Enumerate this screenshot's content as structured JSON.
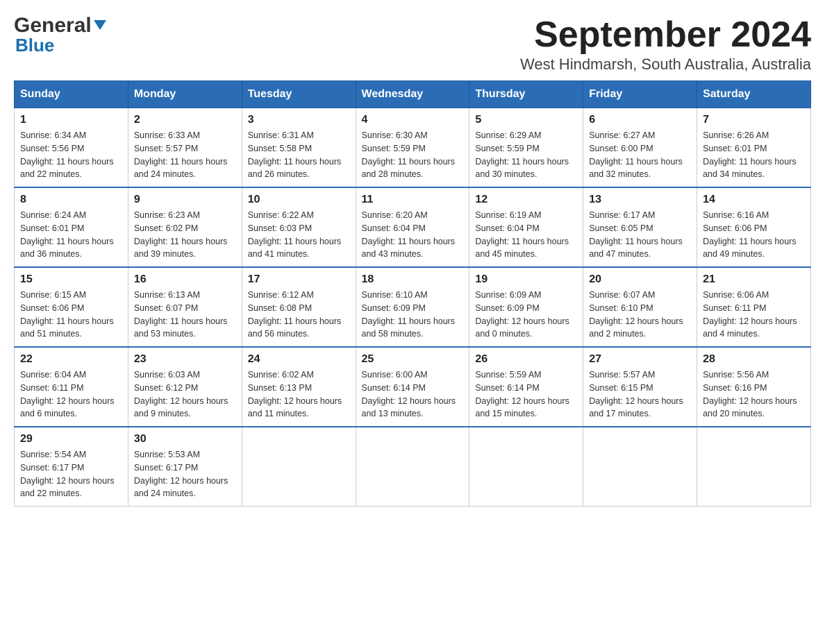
{
  "logo": {
    "line1_normal": "General",
    "line1_arrow": "▶",
    "line2": "Blue"
  },
  "title": "September 2024",
  "subtitle": "West Hindmarsh, South Australia, Australia",
  "weekdays": [
    "Sunday",
    "Monday",
    "Tuesday",
    "Wednesday",
    "Thursday",
    "Friday",
    "Saturday"
  ],
  "weeks": [
    [
      {
        "day": "1",
        "sunrise": "6:34 AM",
        "sunset": "5:56 PM",
        "daylight": "11 hours and 22 minutes."
      },
      {
        "day": "2",
        "sunrise": "6:33 AM",
        "sunset": "5:57 PM",
        "daylight": "11 hours and 24 minutes."
      },
      {
        "day": "3",
        "sunrise": "6:31 AM",
        "sunset": "5:58 PM",
        "daylight": "11 hours and 26 minutes."
      },
      {
        "day": "4",
        "sunrise": "6:30 AM",
        "sunset": "5:59 PM",
        "daylight": "11 hours and 28 minutes."
      },
      {
        "day": "5",
        "sunrise": "6:29 AM",
        "sunset": "5:59 PM",
        "daylight": "11 hours and 30 minutes."
      },
      {
        "day": "6",
        "sunrise": "6:27 AM",
        "sunset": "6:00 PM",
        "daylight": "11 hours and 32 minutes."
      },
      {
        "day": "7",
        "sunrise": "6:26 AM",
        "sunset": "6:01 PM",
        "daylight": "11 hours and 34 minutes."
      }
    ],
    [
      {
        "day": "8",
        "sunrise": "6:24 AM",
        "sunset": "6:01 PM",
        "daylight": "11 hours and 36 minutes."
      },
      {
        "day": "9",
        "sunrise": "6:23 AM",
        "sunset": "6:02 PM",
        "daylight": "11 hours and 39 minutes."
      },
      {
        "day": "10",
        "sunrise": "6:22 AM",
        "sunset": "6:03 PM",
        "daylight": "11 hours and 41 minutes."
      },
      {
        "day": "11",
        "sunrise": "6:20 AM",
        "sunset": "6:04 PM",
        "daylight": "11 hours and 43 minutes."
      },
      {
        "day": "12",
        "sunrise": "6:19 AM",
        "sunset": "6:04 PM",
        "daylight": "11 hours and 45 minutes."
      },
      {
        "day": "13",
        "sunrise": "6:17 AM",
        "sunset": "6:05 PM",
        "daylight": "11 hours and 47 minutes."
      },
      {
        "day": "14",
        "sunrise": "6:16 AM",
        "sunset": "6:06 PM",
        "daylight": "11 hours and 49 minutes."
      }
    ],
    [
      {
        "day": "15",
        "sunrise": "6:15 AM",
        "sunset": "6:06 PM",
        "daylight": "11 hours and 51 minutes."
      },
      {
        "day": "16",
        "sunrise": "6:13 AM",
        "sunset": "6:07 PM",
        "daylight": "11 hours and 53 minutes."
      },
      {
        "day": "17",
        "sunrise": "6:12 AM",
        "sunset": "6:08 PM",
        "daylight": "11 hours and 56 minutes."
      },
      {
        "day": "18",
        "sunrise": "6:10 AM",
        "sunset": "6:09 PM",
        "daylight": "11 hours and 58 minutes."
      },
      {
        "day": "19",
        "sunrise": "6:09 AM",
        "sunset": "6:09 PM",
        "daylight": "12 hours and 0 minutes."
      },
      {
        "day": "20",
        "sunrise": "6:07 AM",
        "sunset": "6:10 PM",
        "daylight": "12 hours and 2 minutes."
      },
      {
        "day": "21",
        "sunrise": "6:06 AM",
        "sunset": "6:11 PM",
        "daylight": "12 hours and 4 minutes."
      }
    ],
    [
      {
        "day": "22",
        "sunrise": "6:04 AM",
        "sunset": "6:11 PM",
        "daylight": "12 hours and 6 minutes."
      },
      {
        "day": "23",
        "sunrise": "6:03 AM",
        "sunset": "6:12 PM",
        "daylight": "12 hours and 9 minutes."
      },
      {
        "day": "24",
        "sunrise": "6:02 AM",
        "sunset": "6:13 PM",
        "daylight": "12 hours and 11 minutes."
      },
      {
        "day": "25",
        "sunrise": "6:00 AM",
        "sunset": "6:14 PM",
        "daylight": "12 hours and 13 minutes."
      },
      {
        "day": "26",
        "sunrise": "5:59 AM",
        "sunset": "6:14 PM",
        "daylight": "12 hours and 15 minutes."
      },
      {
        "day": "27",
        "sunrise": "5:57 AM",
        "sunset": "6:15 PM",
        "daylight": "12 hours and 17 minutes."
      },
      {
        "day": "28",
        "sunrise": "5:56 AM",
        "sunset": "6:16 PM",
        "daylight": "12 hours and 20 minutes."
      }
    ],
    [
      {
        "day": "29",
        "sunrise": "5:54 AM",
        "sunset": "6:17 PM",
        "daylight": "12 hours and 22 minutes."
      },
      {
        "day": "30",
        "sunrise": "5:53 AM",
        "sunset": "6:17 PM",
        "daylight": "12 hours and 24 minutes."
      },
      null,
      null,
      null,
      null,
      null
    ]
  ]
}
